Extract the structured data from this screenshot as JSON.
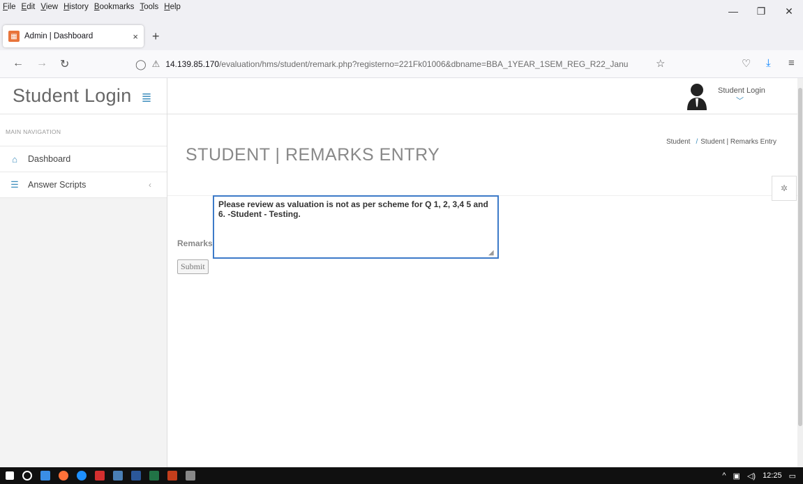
{
  "menubar": {
    "items": [
      "File",
      "Edit",
      "View",
      "History",
      "Bookmarks",
      "Tools",
      "Help"
    ]
  },
  "tab": {
    "title": "Admin | Dashboard",
    "close": "×",
    "new_tab": "+"
  },
  "address": {
    "host": "14.139.85.170",
    "path": "/evaluation/hms/student/remark.php?registerno=221Fk01006&dbname=BBA_1YEAR_1SEM_REG_R22_Janu"
  },
  "sidebar": {
    "brand": "Student Login",
    "nav_header": "MAIN NAVIGATION",
    "items": [
      {
        "label": "Dashboard",
        "icon": "home-icon"
      },
      {
        "label": "Answer Scripts",
        "icon": "list-icon"
      }
    ]
  },
  "topbar": {
    "user_name": "Student Login"
  },
  "main": {
    "title": "STUDENT | REMARKS ENTRY",
    "breadcrumb": {
      "root": "Student",
      "current": "Student | Remarks Entry"
    },
    "remarks_label": "Remarks:",
    "remarks_value": "Please review as valuation is not as per scheme for Q 1, 2, 3,4 5 and 6. -Student - Testing.",
    "submit_label": "Submit"
  },
  "taskbar": {
    "time": "12:25"
  },
  "colors": {
    "accent": "#3c8dbc",
    "focus_border": "#3c7ac8"
  }
}
